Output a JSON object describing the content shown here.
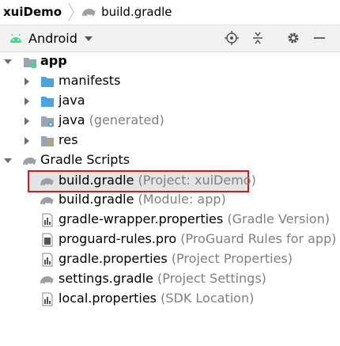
{
  "breadcrumb": {
    "project": "xuiDemo",
    "file": "build.gradle"
  },
  "toolbar": {
    "view_mode": "Android"
  },
  "tree": {
    "app": "app",
    "manifests": "manifests",
    "java": "java",
    "java_generated": "java",
    "java_generated_hint": "(generated)",
    "res": "res",
    "gradle_scripts": "Gradle Scripts",
    "files": [
      {
        "name": "build.gradle",
        "hint": "(Project: xuiDemo)"
      },
      {
        "name": "build.gradle",
        "hint": "(Module: app)"
      },
      {
        "name": "gradle-wrapper.properties",
        "hint": "(Gradle Version)"
      },
      {
        "name": "proguard-rules.pro",
        "hint": "(ProGuard Rules for app)"
      },
      {
        "name": "gradle.properties",
        "hint": "(Project Properties)"
      },
      {
        "name": "settings.gradle",
        "hint": "(Project Settings)"
      },
      {
        "name": "local.properties",
        "hint": "(SDK Location)"
      }
    ]
  },
  "colors": {
    "selection_border": "#d11b1b",
    "folder": "#4aa3df",
    "android_green": "#3ddc84"
  }
}
